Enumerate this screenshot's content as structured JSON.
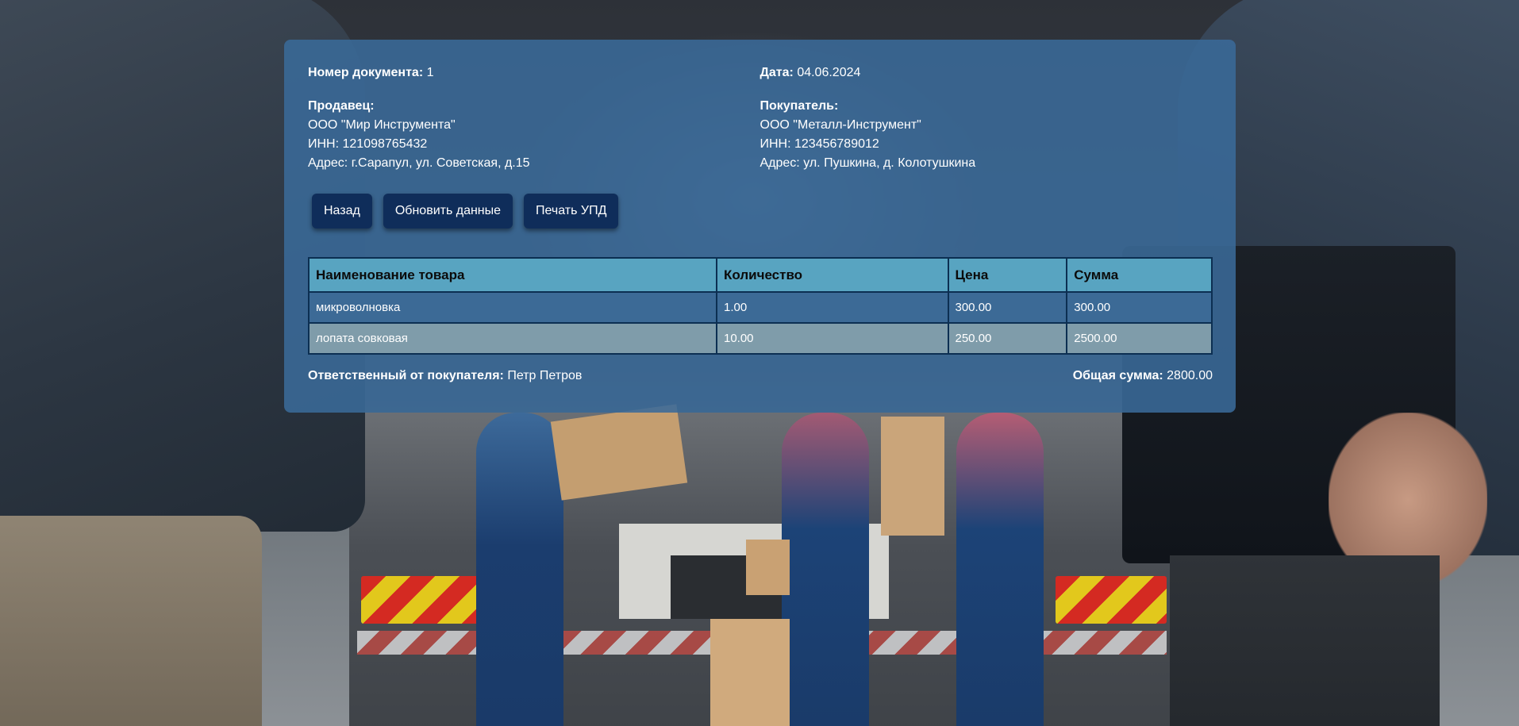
{
  "document": {
    "number_label": "Номер документа:",
    "number_value": "1",
    "date_label": "Дата:",
    "date_value": "04.06.2024"
  },
  "seller": {
    "label": "Продавец:",
    "name": "ООО \"Мир Инструмента\"",
    "inn": "ИНН: 121098765432",
    "address": "Адрес: г.Сарапул, ул. Советская, д.15"
  },
  "buyer": {
    "label": "Покупатель:",
    "name": "ООО \"Металл-Инструмент\"",
    "inn": "ИНН: 123456789012",
    "address": "Адрес: ул. Пушкина, д. Колотушкина"
  },
  "actions": {
    "back": "Назад",
    "refresh": "Обновить данные",
    "print": "Печать УПД"
  },
  "table": {
    "headers": [
      "Наименование товара",
      "Количество",
      "Цена",
      "Сумма"
    ],
    "rows": [
      [
        "микроволновка",
        "1.00",
        "300.00",
        "300.00"
      ],
      [
        "лопата совковая",
        "10.00",
        "250.00",
        "2500.00"
      ]
    ]
  },
  "footer": {
    "responsible_label": "Ответственный от покупателя:",
    "responsible_value": "Петр Петров",
    "total_label": "Общая сумма:",
    "total_value": "2800.00"
  },
  "colors": {
    "panel": "#3a6a98",
    "button": "#0f2d5a",
    "table_header": "#58a4c1",
    "row_even": "#3c6a96",
    "row_odd": "#7f9caa"
  }
}
